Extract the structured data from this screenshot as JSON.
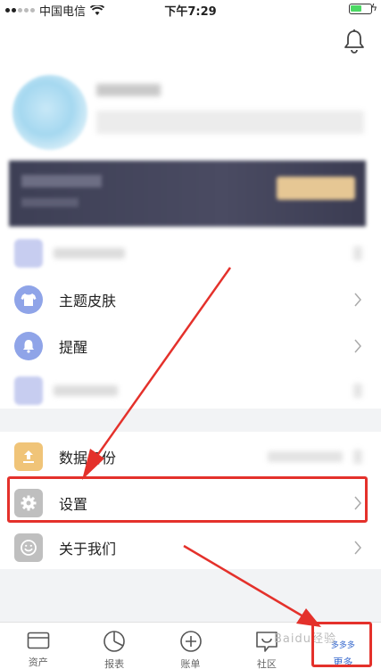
{
  "status": {
    "carrier": "中国电信",
    "time": "下午7:29",
    "bolt": "ϟ"
  },
  "menu": {
    "theme": "主题皮肤",
    "remind": "提醒",
    "backup": "数据备份",
    "settings": "设置",
    "about": "关于我们"
  },
  "tabs": [
    {
      "label": "资产"
    },
    {
      "label": "报表"
    },
    {
      "label": "账单"
    },
    {
      "label": "社区"
    },
    {
      "label": "更多"
    }
  ],
  "active_tab_badge": "多多多",
  "watermark": "Baidu经验",
  "colors": {
    "highlight": "#e4312b",
    "theme_icon": "#8fa4e8",
    "remind_icon": "#8fa4e8",
    "backup_icon": "#f0c478",
    "settings_icon": "#bfbfbf",
    "about_icon": "#bfbfbf",
    "active_tab": "#3366cc"
  }
}
